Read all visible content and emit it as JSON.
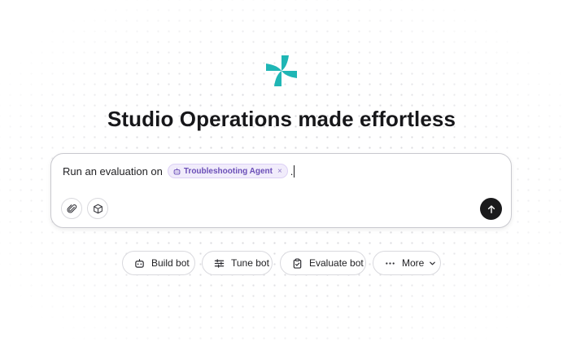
{
  "brand": {
    "logo_icon": "pinwheel-logo-icon",
    "accent_color": "#1fb6b5"
  },
  "hero": {
    "title": "Studio Operations made effortless"
  },
  "composer": {
    "prompt_text": "Run an evaluation on",
    "mention_chip": {
      "icon": "bot-icon",
      "label": "Troubleshooting Agent",
      "remove_label": "×"
    },
    "trailing_text": ".",
    "tools": [
      {
        "name": "attach",
        "icon": "paperclip-icon"
      },
      {
        "name": "objects",
        "icon": "cube-icon"
      }
    ],
    "send_icon": "arrow-up-icon"
  },
  "quick_actions": [
    {
      "label": "Build bot",
      "icon": "bot-icon"
    },
    {
      "label": "Tune bot",
      "icon": "sliders-icon"
    },
    {
      "label": "Evaluate bot",
      "icon": "clipboard-icon"
    },
    {
      "label": "More",
      "icon": "ellipsis-icon",
      "trailing_icon": "chevron-down-icon"
    }
  ]
}
